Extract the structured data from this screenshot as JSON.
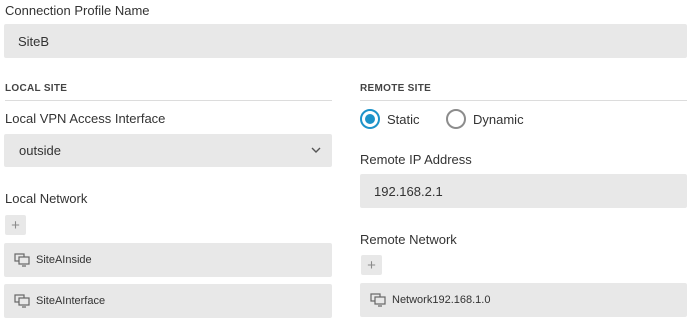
{
  "profile": {
    "label": "Connection Profile Name",
    "value": "SiteB"
  },
  "local": {
    "title": "LOCAL SITE",
    "interface_label": "Local VPN Access Interface",
    "interface_value": "outside",
    "network_label": "Local Network",
    "add_symbol": "+",
    "networks": [
      "SiteAInside",
      "SiteAInterface"
    ]
  },
  "remote": {
    "title": "REMOTE SITE",
    "mode_options": [
      "Static",
      "Dynamic"
    ],
    "mode_selected": "Static",
    "ip_label": "Remote IP Address",
    "ip_value": "192.168.2.1",
    "network_label": "Remote Network",
    "add_symbol": "+",
    "networks": [
      "Network192.168.1.0"
    ]
  },
  "colors": {
    "accent": "#1d93c9",
    "field_bg": "#e8e8e8"
  }
}
